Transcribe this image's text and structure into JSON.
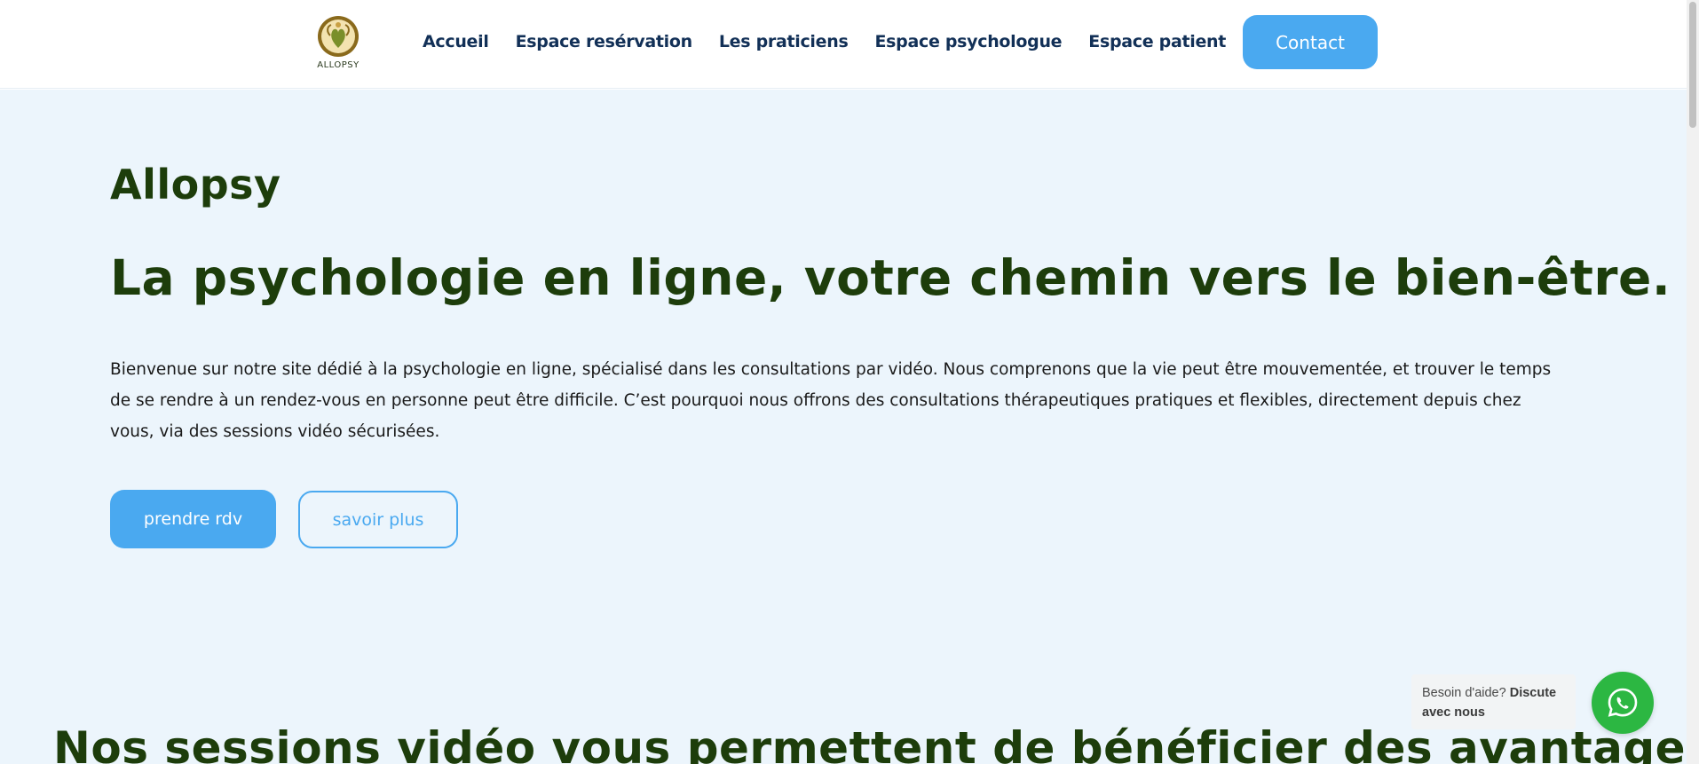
{
  "header": {
    "logo_text": "ALLOPSY",
    "nav": [
      {
        "label": "Accueil"
      },
      {
        "label": "Espace resérvation"
      },
      {
        "label": "Les praticiens"
      },
      {
        "label": "Espace psychologue"
      },
      {
        "label": "Espace patient"
      }
    ],
    "contact_label": "Contact"
  },
  "hero": {
    "brand_title": "Allopsy",
    "headline": "La psychologie en ligne, votre chemin vers le bien-être.",
    "intro": "Bienvenue sur notre site dédié à la psychologie en ligne, spécialisé dans les consultations par vidéo. Nous comprenons que la vie peut être mouvementée, et trouver le temps de se rendre à un rendez-vous en personne peut être difficile. C’est pourquoi nous offrons des consultations thérapeutiques pratiques et flexibles, directement depuis chez vous, via des sessions vidéo sécurisées.",
    "primary_button": "prendre rdv",
    "secondary_button": "savoir plus"
  },
  "section": {
    "title": "Nos sessions vidéo vous permettent de bénéficier des avantages"
  },
  "help": {
    "text_prefix": "Besoin d'aide?",
    "text_bold": "Discute avec nous",
    "icon": "whatsapp-icon"
  },
  "colors": {
    "accent": "#4aa9f0",
    "nav_text": "#123057",
    "heading_green": "#1d3d0b",
    "hero_bg": "#ecf5fc",
    "whatsapp_green": "#2cb742"
  }
}
